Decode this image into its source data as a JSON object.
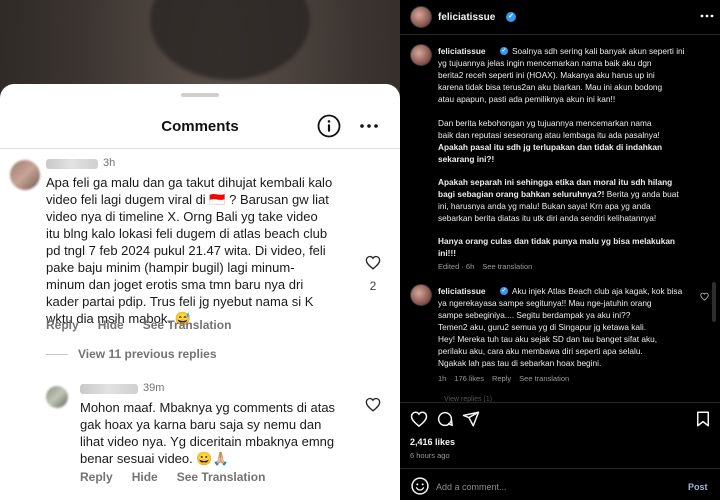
{
  "comments_sheet": {
    "title": "Comments",
    "comments": [
      {
        "timestamp": "3h",
        "lines": [
          "Apa feli ga malu dan ga takut dihujat kembali kalo",
          "video feli lagi dugem viral di 🇮🇩 ? Barusan gw liat",
          "video nya di timeline X. Orng Bali yg take video",
          "itu blng kalo lokasi feli dugem di atlas beach club",
          "pd tngl 7 feb 2024 pukul 21.47 wita. Di video, feli",
          "pake baju minim (hampir bugil) lagi minum-",
          "minum dan joget erotis sma tmn baru nya dri",
          "kader partai pdip. Trus feli jg nyebut nama si K",
          "wktu dia msih mabok. 😅"
        ],
        "reply_label": "Reply",
        "hide_label": "Hide",
        "translate_label": "See Translation",
        "like_count": "2"
      },
      {
        "timestamp": "39m",
        "lines": [
          "Mohon maaf. Mbaknya yg comments di atas",
          "gak hoax ya karna baru saja sy nemu dan",
          "lihat video nya. Yg diceritain mbaknya emng",
          "benar sesuai video. 😀🙏🏼"
        ],
        "reply_label": "Reply",
        "hide_label": "Hide",
        "translate_label": "See Translation"
      }
    ],
    "view_previous": "View 11 previous replies"
  },
  "post_panel": {
    "username": "feliciatissue",
    "caption": {
      "username": "feliciatissue",
      "paragraph1": [
        "Soalnya sdh sering kali banyak akun seperti ini",
        "yg tujuannya jelas ingin mencemarkan nama baik aku dgn",
        "berita2 receh seperti ini (HOAX). Makanya aku harus up ini",
        "karena tidak bisa terus2an aku biarkan. Mau ini akun bodong",
        "atau apapun, pasti ada pemiliknya akun ini kan!!"
      ],
      "paragraph2": [
        "Dan berita kebohongan yg tujuannya mencemarkan nama",
        "baik dan reputasi seseorang atau lembaga itu ada pasalnya!"
      ],
      "paragraph2_bold": [
        "Apakah pasal itu sdh jg terlupakan dan tidak di indahkan",
        "sekarang ini?!"
      ],
      "paragraph3_bold": [
        "Apakah separah ini sehingga etika dan moral itu sdh hilang",
        "bagi sebagian orang bahkan seluruhnya?!"
      ],
      "paragraph3_rest": [
        " Berita yg anda buat",
        "ini, harusnya anda yg malu! Bukan saya! Krn apa yg anda",
        "sebarkan berita diatas itu utk diri anda sendiri kelihatannya!"
      ],
      "paragraph4_bold": [
        "Hanya orang culas dan tidak punya malu yg bisa melakukan",
        "ini!!!"
      ],
      "meta": [
        "Edited · 6h",
        "See translation"
      ]
    },
    "reply": {
      "username": "feliciatissue",
      "lines": [
        "Aku injek Atlas Beach club aja kagak, kok bisa",
        "ya ngerekayasa sampe segitunya!! Mau nge-jatuhin orang",
        "sampe sebeginiya.... Segitu berdampak ya aku ini??",
        "Temen2 aku, guru2 semua yg di Singapur jg ketawa kali.",
        "Hey! Mereka tuh tau aku sejak SD dan tau banget sifat aku,",
        "perilaku aku, cara aku membawa diri seperti apa selalu.",
        "Ngakak lah pas tau di sebarkan hoax begini."
      ],
      "meta": [
        "1h",
        "176 likes",
        "Reply",
        "See translation"
      ]
    },
    "faded_text": "View replies (1)",
    "likes": "2,416 likes",
    "time_ago": "6 hours ago",
    "add_comment_placeholder": "Add a comment...",
    "post_label": "Post"
  }
}
